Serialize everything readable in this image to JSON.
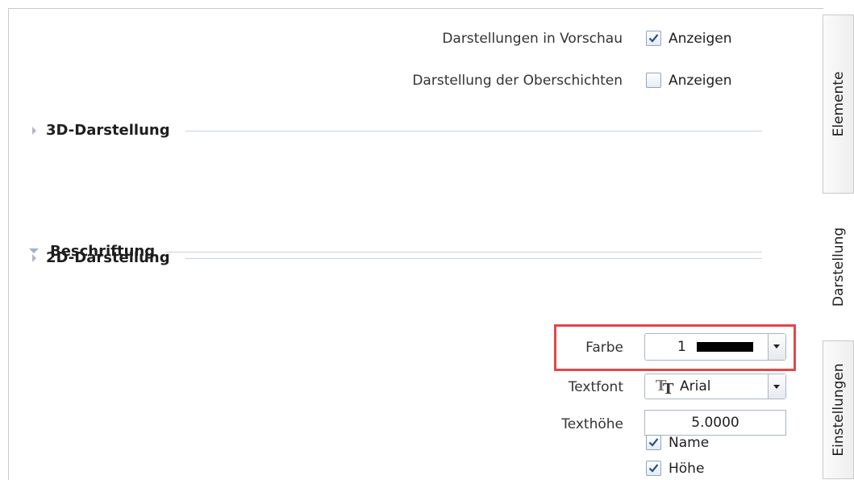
{
  "options": {
    "preview_label": "Darstellungen in Vorschau",
    "preview_checkbox_label": "Anzeigen",
    "preview_checked": true,
    "layers_label": "Darstellung der Oberschichten",
    "layers_checkbox_label": "Anzeigen",
    "layers_checked": false
  },
  "sections": {
    "s3d": "3D-Darstellung",
    "s2d": "2D-Darstellung",
    "labeling": "Beschriftung"
  },
  "labeling": {
    "color_label": "Farbe",
    "color_value": "1",
    "color_swatch": "#000000",
    "font_label": "Textfont",
    "font_value": "Arial",
    "height_label": "Texthöhe",
    "height_value": "5.0000",
    "name_label": "Name",
    "name_checked": true,
    "hoehe_label": "Höhe",
    "hoehe_checked": true
  },
  "tabs": {
    "elements": "Elemente",
    "display": "Darstellung",
    "settings": "Einstellungen"
  },
  "colors": {
    "highlight": "#e2474a",
    "check": "#2b4f86"
  }
}
